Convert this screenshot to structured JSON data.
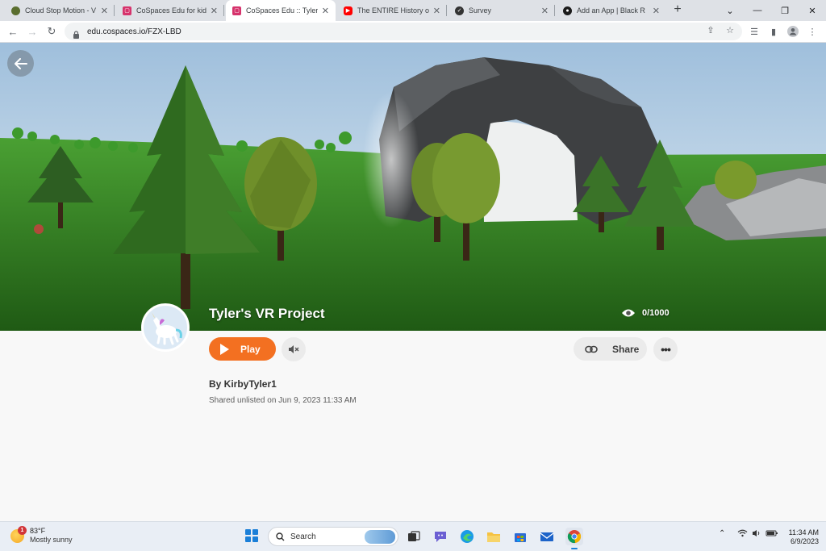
{
  "browser": {
    "tabs": [
      {
        "title": "Cloud Stop Motion - V",
        "icon": "cloud-stop-motion-icon",
        "color": "#5a6e2f"
      },
      {
        "title": "CoSpaces Edu for kid",
        "icon": "cospaces-icon",
        "color": "#d6336c"
      },
      {
        "title": "CoSpaces Edu :: Tyler",
        "icon": "cospaces-icon",
        "color": "#d6336c"
      },
      {
        "title": "The ENTIRE History of",
        "icon": "youtube-icon",
        "color": "#ff0000"
      },
      {
        "title": "Survey",
        "icon": "survey-icon",
        "color": "#333333"
      },
      {
        "title": "Add an App | Black R",
        "icon": "app-icon",
        "color": "#1b1b1b"
      }
    ],
    "active_tab": 2,
    "url": "edu.cospaces.io/FZX-LBD"
  },
  "project": {
    "title": "Tyler's VR Project",
    "views": "0/1000",
    "play_label": "Play",
    "share_label": "Share",
    "author": "By KirbyTyler1",
    "shared": "Shared unlisted on Jun 9, 2023 11:33 AM",
    "accent_color": "#f37021"
  },
  "taskbar": {
    "weather_temp": "83°F",
    "weather_cond": "Mostly sunny",
    "weather_badge": "1",
    "search_placeholder": "Search",
    "time": "11:34 AM",
    "date": "6/9/2023"
  }
}
